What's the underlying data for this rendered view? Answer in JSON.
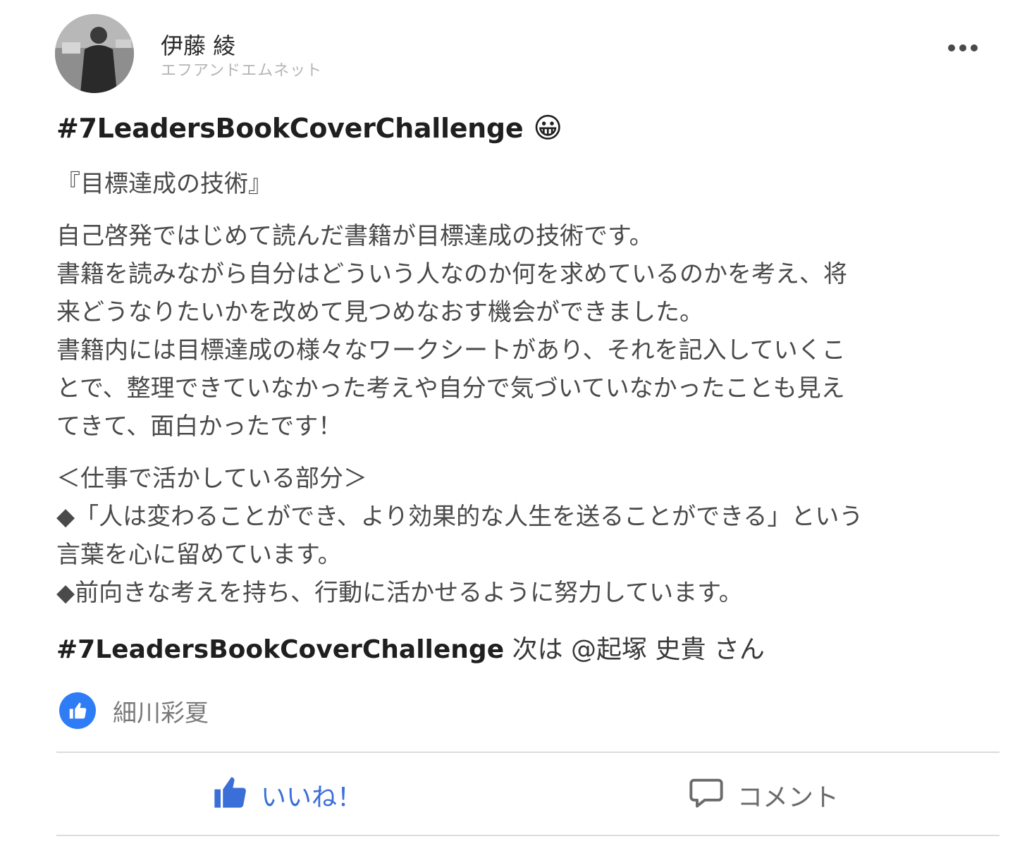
{
  "post": {
    "author": {
      "name": "伊藤 綾",
      "org": "エフアンドエムネット"
    },
    "hashtag_title": "#7LeadersBookCoverChallenge",
    "title_emoji": "😀",
    "book_title": "『目標達成の技術』",
    "paragraph1": [
      "自己啓発ではじめて読んだ書籍が目標達成の技術です。",
      "書籍を読みながら自分はどういう人なのか何を求めているのかを考え、将",
      "来どうなりたいかを改めて見つめなおす機会ができました。",
      "書籍内には目標達成の様々なワークシートがあり、それを記入していくこ",
      "とで、整理できていなかった考えや自分で気づいていなかったことも見え",
      "てきて、面白かったです！"
    ],
    "section_heading": "＜仕事で活かしている部分＞",
    "bullets": [
      "◆「人は変わることができ、より効果的な人生を送ることができる」という",
      "言葉を心に留めています。",
      "◆前向きな考えを持ち、行動に活かせるように努力しています。"
    ],
    "footer_hashtag": "#7LeadersBookCoverChallenge",
    "footer_text": " 次は @起塚 史貴 さん",
    "reactions": {
      "names": "細川彩夏"
    },
    "actions": {
      "like_label": "いいね！",
      "comment_label": "コメント"
    }
  },
  "colors": {
    "like_blue": "#2e7cf6",
    "like_label": "#3b6fd8",
    "muted": "#7a7a7a"
  }
}
